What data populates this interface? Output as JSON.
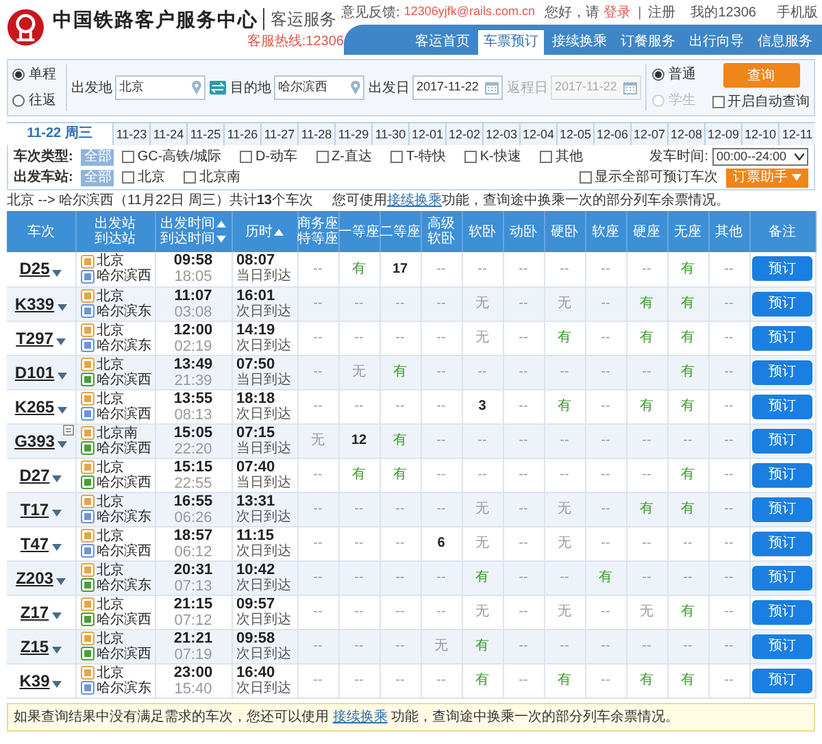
{
  "header": {
    "site_title": "中国铁路客户服务中心",
    "section": "客运服务",
    "hotline": "客服热线:12306",
    "top_links": {
      "feedback_label": "意见反馈:",
      "feedback_email": "12306yjfk@rails.com.cn",
      "greeting": "您好，请",
      "login": "登录",
      "separator": "|",
      "register": "注册",
      "my_account": "我的12306",
      "mobile": "手机版"
    },
    "nav": [
      {
        "label": "客运首页",
        "selected": false
      },
      {
        "label": "车票预订",
        "selected": true
      },
      {
        "label": "接续换乘",
        "selected": false
      },
      {
        "label": "订餐服务",
        "selected": false
      },
      {
        "label": "出行向导",
        "selected": false
      },
      {
        "label": "信息服务",
        "selected": false
      }
    ]
  },
  "search": {
    "trip_type": [
      {
        "label": "单程",
        "selected": true
      },
      {
        "label": "往返",
        "selected": false
      }
    ],
    "from": {
      "label": "出发地",
      "value": "北京"
    },
    "to": {
      "label": "目的地",
      "value": "哈尔滨西"
    },
    "depart_date": {
      "label": "出发日",
      "value": "2017-11-22",
      "disabled": false
    },
    "return_date": {
      "label": "返程日",
      "value": "2017-11-22",
      "disabled": true
    },
    "passenger_type": [
      {
        "label": "普通",
        "selected": true,
        "disabled": false
      },
      {
        "label": "学生",
        "selected": false,
        "disabled": true
      }
    ],
    "query_button": "查询",
    "auto_query": {
      "label": "开启自动查询",
      "checked": false
    }
  },
  "dates": [
    {
      "label": "11-22 周三",
      "selected": true
    },
    {
      "label": "11-23",
      "selected": false
    },
    {
      "label": "11-24",
      "selected": false
    },
    {
      "label": "11-25",
      "selected": false
    },
    {
      "label": "11-26",
      "selected": false
    },
    {
      "label": "11-27",
      "selected": false
    },
    {
      "label": "11-28",
      "selected": false
    },
    {
      "label": "11-29",
      "selected": false
    },
    {
      "label": "11-30",
      "selected": false
    },
    {
      "label": "12-01",
      "selected": false
    },
    {
      "label": "12-02",
      "selected": false
    },
    {
      "label": "12-03",
      "selected": false
    },
    {
      "label": "12-04",
      "selected": false
    },
    {
      "label": "12-05",
      "selected": false
    },
    {
      "label": "12-06",
      "selected": false
    },
    {
      "label": "12-07",
      "selected": false
    },
    {
      "label": "12-08",
      "selected": false
    },
    {
      "label": "12-09",
      "selected": false
    },
    {
      "label": "12-10",
      "selected": false
    },
    {
      "label": "12-11",
      "selected": false
    }
  ],
  "filters": {
    "train_type": {
      "label": "车次类型:",
      "all": "全部",
      "options": [
        {
          "label": "GC-高铁/城际",
          "checked": false
        },
        {
          "label": "D-动车",
          "checked": false
        },
        {
          "label": "Z-直达",
          "checked": false
        },
        {
          "label": "T-特快",
          "checked": false
        },
        {
          "label": "K-快速",
          "checked": false
        },
        {
          "label": "其他",
          "checked": false
        }
      ]
    },
    "depart_time": {
      "label": "发车时间:",
      "value": "00:00--24:00"
    },
    "station": {
      "label": "出发车站:",
      "all": "全部",
      "options": [
        {
          "label": "北京",
          "checked": false
        },
        {
          "label": "北京南",
          "checked": false
        }
      ]
    },
    "show_all": {
      "label": "显示全部可预订车次",
      "checked": false
    },
    "helper_button": "订票助手"
  },
  "summary": {
    "route": "北京 --> 哈尔滨西（11月22日 周三）共计**13**个车次",
    "hint": {
      "before": "您可使用",
      "link": "接续换乘",
      "after": "功能，查询途中换乘一次的部分列车余票情况。"
    }
  },
  "table": {
    "columns": [
      {
        "lines": [
          {
            "text": "车次"
          }
        ]
      },
      {
        "lines": [
          {
            "text": "出发站"
          },
          {
            "text": "到达站"
          }
        ]
      },
      {
        "lines": [
          {
            "text": "出发时间",
            "kind": "ascending"
          },
          {
            "text": "到达时间",
            "kind": "descending"
          }
        ]
      },
      {
        "lines": [
          {
            "text": "历时",
            "kind": "ascending"
          }
        ]
      },
      {
        "lines": [
          {
            "text": "商务座"
          },
          {
            "text": "特等座"
          }
        ]
      },
      {
        "lines": [
          {
            "text": "一等座"
          }
        ]
      },
      {
        "lines": [
          {
            "text": "二等座"
          }
        ]
      },
      {
        "lines": [
          {
            "text": "高级"
          },
          {
            "text": "软卧"
          }
        ]
      },
      {
        "lines": [
          {
            "text": "软卧"
          }
        ]
      },
      {
        "lines": [
          {
            "text": "动卧"
          }
        ]
      },
      {
        "lines": [
          {
            "text": "硬卧"
          }
        ]
      },
      {
        "lines": [
          {
            "text": "软座"
          }
        ]
      },
      {
        "lines": [
          {
            "text": "硬座"
          }
        ]
      },
      {
        "lines": [
          {
            "text": "无座"
          }
        ]
      },
      {
        "lines": [
          {
            "text": "其他"
          }
        ]
      },
      {
        "lines": [
          {
            "text": "备注"
          }
        ]
      }
    ],
    "rows": [
      {
        "train": "D25",
        "extra_icon": false,
        "from": "北京",
        "to": "哈尔滨西",
        "terminates": false,
        "depart": "09:58",
        "arrive": "18:05",
        "duration": "08:07",
        "arrival_day": "当日到达",
        "seats": [
          {
            "text": "--",
            "kind": "na"
          },
          {
            "text": "有",
            "kind": "yes"
          },
          {
            "text": "17",
            "kind": "count"
          },
          {
            "text": "--",
            "kind": "na"
          },
          {
            "text": "--",
            "kind": "na"
          },
          {
            "text": "--",
            "kind": "na"
          },
          {
            "text": "--",
            "kind": "na"
          },
          {
            "text": "--",
            "kind": "na"
          },
          {
            "text": "--",
            "kind": "na"
          },
          {
            "text": "有",
            "kind": "yes"
          },
          {
            "text": "--",
            "kind": "na"
          }
        ],
        "button": "预订"
      },
      {
        "train": "K339",
        "extra_icon": false,
        "from": "北京",
        "to": "哈尔滨东",
        "terminates": false,
        "depart": "11:07",
        "arrive": "03:08",
        "duration": "16:01",
        "arrival_day": "次日到达",
        "seats": [
          {
            "text": "--",
            "kind": "na"
          },
          {
            "text": "--",
            "kind": "na"
          },
          {
            "text": "--",
            "kind": "na"
          },
          {
            "text": "--",
            "kind": "na"
          },
          {
            "text": "无",
            "kind": "no"
          },
          {
            "text": "--",
            "kind": "na"
          },
          {
            "text": "无",
            "kind": "no"
          },
          {
            "text": "--",
            "kind": "na"
          },
          {
            "text": "有",
            "kind": "yes"
          },
          {
            "text": "有",
            "kind": "yes"
          },
          {
            "text": "--",
            "kind": "na"
          }
        ],
        "button": "预订"
      },
      {
        "train": "T297",
        "extra_icon": false,
        "from": "北京",
        "to": "哈尔滨东",
        "terminates": false,
        "depart": "12:00",
        "arrive": "02:19",
        "duration": "14:19",
        "arrival_day": "次日到达",
        "seats": [
          {
            "text": "--",
            "kind": "na"
          },
          {
            "text": "--",
            "kind": "na"
          },
          {
            "text": "--",
            "kind": "na"
          },
          {
            "text": "--",
            "kind": "na"
          },
          {
            "text": "无",
            "kind": "no"
          },
          {
            "text": "--",
            "kind": "na"
          },
          {
            "text": "有",
            "kind": "yes"
          },
          {
            "text": "--",
            "kind": "na"
          },
          {
            "text": "有",
            "kind": "yes"
          },
          {
            "text": "有",
            "kind": "yes"
          },
          {
            "text": "--",
            "kind": "na"
          }
        ],
        "button": "预订"
      },
      {
        "train": "D101",
        "extra_icon": false,
        "from": "北京",
        "to": "哈尔滨西",
        "terminates": true,
        "depart": "13:49",
        "arrive": "21:39",
        "duration": "07:50",
        "arrival_day": "当日到达",
        "seats": [
          {
            "text": "--",
            "kind": "na"
          },
          {
            "text": "无",
            "kind": "no"
          },
          {
            "text": "有",
            "kind": "yes"
          },
          {
            "text": "--",
            "kind": "na"
          },
          {
            "text": "--",
            "kind": "na"
          },
          {
            "text": "--",
            "kind": "na"
          },
          {
            "text": "--",
            "kind": "na"
          },
          {
            "text": "--",
            "kind": "na"
          },
          {
            "text": "--",
            "kind": "na"
          },
          {
            "text": "有",
            "kind": "yes"
          },
          {
            "text": "--",
            "kind": "na"
          }
        ],
        "button": "预订"
      },
      {
        "train": "K265",
        "extra_icon": false,
        "from": "北京",
        "to": "哈尔滨西",
        "terminates": false,
        "depart": "13:55",
        "arrive": "08:13",
        "duration": "18:18",
        "arrival_day": "次日到达",
        "seats": [
          {
            "text": "--",
            "kind": "na"
          },
          {
            "text": "--",
            "kind": "na"
          },
          {
            "text": "--",
            "kind": "na"
          },
          {
            "text": "--",
            "kind": "na"
          },
          {
            "text": "3",
            "kind": "count"
          },
          {
            "text": "--",
            "kind": "na"
          },
          {
            "text": "有",
            "kind": "yes"
          },
          {
            "text": "--",
            "kind": "na"
          },
          {
            "text": "有",
            "kind": "yes"
          },
          {
            "text": "有",
            "kind": "yes"
          },
          {
            "text": "--",
            "kind": "na"
          }
        ],
        "button": "预订"
      },
      {
        "train": "G393",
        "extra_icon": true,
        "from": "北京南",
        "to": "哈尔滨西",
        "terminates": true,
        "depart": "15:05",
        "arrive": "22:20",
        "duration": "07:15",
        "arrival_day": "当日到达",
        "seats": [
          {
            "text": "无",
            "kind": "no"
          },
          {
            "text": "12",
            "kind": "count"
          },
          {
            "text": "有",
            "kind": "yes"
          },
          {
            "text": "--",
            "kind": "na"
          },
          {
            "text": "--",
            "kind": "na"
          },
          {
            "text": "--",
            "kind": "na"
          },
          {
            "text": "--",
            "kind": "na"
          },
          {
            "text": "--",
            "kind": "na"
          },
          {
            "text": "--",
            "kind": "na"
          },
          {
            "text": "--",
            "kind": "na"
          },
          {
            "text": "--",
            "kind": "na"
          }
        ],
        "button": "预订"
      },
      {
        "train": "D27",
        "extra_icon": false,
        "from": "北京",
        "to": "哈尔滨西",
        "terminates": true,
        "depart": "15:15",
        "arrive": "22:55",
        "duration": "07:40",
        "arrival_day": "当日到达",
        "seats": [
          {
            "text": "--",
            "kind": "na"
          },
          {
            "text": "有",
            "kind": "yes"
          },
          {
            "text": "有",
            "kind": "yes"
          },
          {
            "text": "--",
            "kind": "na"
          },
          {
            "text": "--",
            "kind": "na"
          },
          {
            "text": "--",
            "kind": "na"
          },
          {
            "text": "--",
            "kind": "na"
          },
          {
            "text": "--",
            "kind": "na"
          },
          {
            "text": "--",
            "kind": "na"
          },
          {
            "text": "有",
            "kind": "yes"
          },
          {
            "text": "--",
            "kind": "na"
          }
        ],
        "button": "预订"
      },
      {
        "train": "T17",
        "extra_icon": false,
        "from": "北京",
        "to": "哈尔滨东",
        "terminates": false,
        "depart": "16:55",
        "arrive": "06:26",
        "duration": "13:31",
        "arrival_day": "次日到达",
        "seats": [
          {
            "text": "--",
            "kind": "na"
          },
          {
            "text": "--",
            "kind": "na"
          },
          {
            "text": "--",
            "kind": "na"
          },
          {
            "text": "--",
            "kind": "na"
          },
          {
            "text": "无",
            "kind": "no"
          },
          {
            "text": "--",
            "kind": "na"
          },
          {
            "text": "无",
            "kind": "no"
          },
          {
            "text": "--",
            "kind": "na"
          },
          {
            "text": "有",
            "kind": "yes"
          },
          {
            "text": "有",
            "kind": "yes"
          },
          {
            "text": "--",
            "kind": "na"
          }
        ],
        "button": "预订"
      },
      {
        "train": "T47",
        "extra_icon": false,
        "from": "北京",
        "to": "哈尔滨西",
        "terminates": false,
        "depart": "18:57",
        "arrive": "06:12",
        "duration": "11:15",
        "arrival_day": "次日到达",
        "seats": [
          {
            "text": "--",
            "kind": "na"
          },
          {
            "text": "--",
            "kind": "na"
          },
          {
            "text": "--",
            "kind": "na"
          },
          {
            "text": "6",
            "kind": "count"
          },
          {
            "text": "无",
            "kind": "no"
          },
          {
            "text": "--",
            "kind": "na"
          },
          {
            "text": "无",
            "kind": "no"
          },
          {
            "text": "--",
            "kind": "na"
          },
          {
            "text": "--",
            "kind": "na"
          },
          {
            "text": "--",
            "kind": "na"
          },
          {
            "text": "--",
            "kind": "na"
          }
        ],
        "button": "预订"
      },
      {
        "train": "Z203",
        "extra_icon": false,
        "from": "北京",
        "to": "哈尔滨东",
        "terminates": true,
        "depart": "20:31",
        "arrive": "07:13",
        "duration": "10:42",
        "arrival_day": "次日到达",
        "seats": [
          {
            "text": "--",
            "kind": "na"
          },
          {
            "text": "--",
            "kind": "na"
          },
          {
            "text": "--",
            "kind": "na"
          },
          {
            "text": "--",
            "kind": "na"
          },
          {
            "text": "有",
            "kind": "yes"
          },
          {
            "text": "--",
            "kind": "na"
          },
          {
            "text": "--",
            "kind": "na"
          },
          {
            "text": "有",
            "kind": "yes"
          },
          {
            "text": "--",
            "kind": "na"
          },
          {
            "text": "--",
            "kind": "na"
          },
          {
            "text": "--",
            "kind": "na"
          }
        ],
        "button": "预订"
      },
      {
        "train": "Z17",
        "extra_icon": false,
        "from": "北京",
        "to": "哈尔滨西",
        "terminates": true,
        "depart": "21:15",
        "arrive": "07:12",
        "duration": "09:57",
        "arrival_day": "次日到达",
        "seats": [
          {
            "text": "--",
            "kind": "na"
          },
          {
            "text": "--",
            "kind": "na"
          },
          {
            "text": "--",
            "kind": "na"
          },
          {
            "text": "--",
            "kind": "na"
          },
          {
            "text": "无",
            "kind": "no"
          },
          {
            "text": "--",
            "kind": "na"
          },
          {
            "text": "无",
            "kind": "no"
          },
          {
            "text": "--",
            "kind": "na"
          },
          {
            "text": "无",
            "kind": "no"
          },
          {
            "text": "有",
            "kind": "yes"
          },
          {
            "text": "--",
            "kind": "na"
          }
        ],
        "button": "预订"
      },
      {
        "train": "Z15",
        "extra_icon": false,
        "from": "北京",
        "to": "哈尔滨西",
        "terminates": true,
        "depart": "21:21",
        "arrive": "07:19",
        "duration": "09:58",
        "arrival_day": "次日到达",
        "seats": [
          {
            "text": "--",
            "kind": "na"
          },
          {
            "text": "--",
            "kind": "na"
          },
          {
            "text": "--",
            "kind": "na"
          },
          {
            "text": "无",
            "kind": "no"
          },
          {
            "text": "有",
            "kind": "yes"
          },
          {
            "text": "--",
            "kind": "na"
          },
          {
            "text": "--",
            "kind": "na"
          },
          {
            "text": "--",
            "kind": "na"
          },
          {
            "text": "--",
            "kind": "na"
          },
          {
            "text": "--",
            "kind": "na"
          },
          {
            "text": "--",
            "kind": "na"
          }
        ],
        "button": "预订"
      },
      {
        "train": "K39",
        "extra_icon": false,
        "from": "北京",
        "to": "哈尔滨东",
        "terminates": false,
        "depart": "23:00",
        "arrive": "15:40",
        "duration": "16:40",
        "arrival_day": "次日到达",
        "seats": [
          {
            "text": "--",
            "kind": "na"
          },
          {
            "text": "--",
            "kind": "na"
          },
          {
            "text": "--",
            "kind": "na"
          },
          {
            "text": "--",
            "kind": "na"
          },
          {
            "text": "有",
            "kind": "yes"
          },
          {
            "text": "--",
            "kind": "na"
          },
          {
            "text": "有",
            "kind": "yes"
          },
          {
            "text": "--",
            "kind": "na"
          },
          {
            "text": "有",
            "kind": "yes"
          },
          {
            "text": "有",
            "kind": "yes"
          },
          {
            "text": "--",
            "kind": "na"
          }
        ],
        "button": "预订"
      }
    ]
  },
  "footer_note": {
    "before": "如果查询结果中没有满足需求的车次，您还可以使用 ",
    "link": "接续换乘",
    "after": " 功能，查询途中换乘一次的部分列车余票情况。"
  }
}
